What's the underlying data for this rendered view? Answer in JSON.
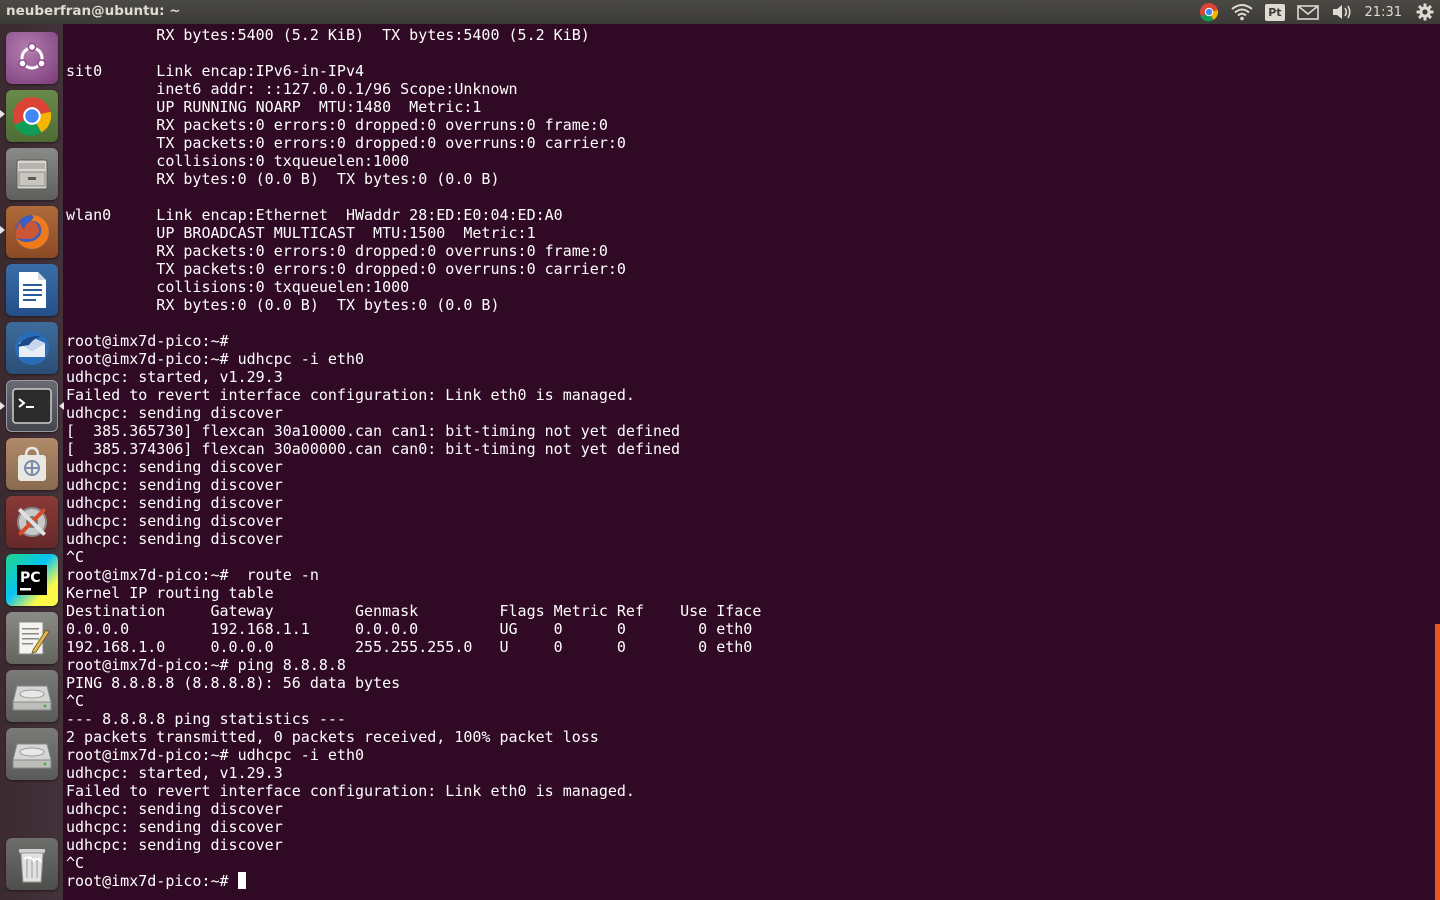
{
  "topbar": {
    "window_title": "neuberfran@ubuntu: ~",
    "clock": "21:31",
    "keyboard_layout": "Pt",
    "indicators": [
      "chrome-icon",
      "wifi-icon",
      "keyboard-layout-indicator",
      "mail-icon",
      "volume-icon",
      "settings-gear-icon"
    ]
  },
  "launcher": {
    "items": [
      {
        "name": "dash-home",
        "icon": "ubuntu-logo-icon"
      },
      {
        "name": "google-chrome",
        "icon": "chrome-icon"
      },
      {
        "name": "files",
        "icon": "file-cabinet-icon"
      },
      {
        "name": "firefox",
        "icon": "firefox-icon"
      },
      {
        "name": "libreoffice-writer",
        "icon": "writer-document-icon"
      },
      {
        "name": "thunderbird",
        "icon": "thunderbird-icon"
      },
      {
        "name": "terminal",
        "icon": "terminal-icon"
      },
      {
        "name": "software-center",
        "icon": "shopping-bag-icon"
      },
      {
        "name": "system-settings",
        "icon": "wrench-screwdriver-icon"
      },
      {
        "name": "pycharm",
        "icon": "pycharm-icon"
      },
      {
        "name": "text-editor",
        "icon": "text-editor-icon"
      },
      {
        "name": "drive-1",
        "icon": "hard-drive-icon"
      },
      {
        "name": "drive-2",
        "icon": "hard-drive-icon"
      },
      {
        "name": "trash",
        "icon": "trash-icon"
      }
    ]
  },
  "terminal": {
    "lines": [
      "          RX bytes:5400 (5.2 KiB)  TX bytes:5400 (5.2 KiB)",
      "",
      "sit0      Link encap:IPv6-in-IPv4",
      "          inet6 addr: ::127.0.0.1/96 Scope:Unknown",
      "          UP RUNNING NOARP  MTU:1480  Metric:1",
      "          RX packets:0 errors:0 dropped:0 overruns:0 frame:0",
      "          TX packets:0 errors:0 dropped:0 overruns:0 carrier:0",
      "          collisions:0 txqueuelen:1000",
      "          RX bytes:0 (0.0 B)  TX bytes:0 (0.0 B)",
      "",
      "wlan0     Link encap:Ethernet  HWaddr 28:ED:E0:04:ED:A0",
      "          UP BROADCAST MULTICAST  MTU:1500  Metric:1",
      "          RX packets:0 errors:0 dropped:0 overruns:0 frame:0",
      "          TX packets:0 errors:0 dropped:0 overruns:0 carrier:0",
      "          collisions:0 txqueuelen:1000",
      "          RX bytes:0 (0.0 B)  TX bytes:0 (0.0 B)",
      "",
      "root@imx7d-pico:~#",
      "root@imx7d-pico:~# udhcpc -i eth0",
      "udhcpc: started, v1.29.3",
      "Failed to revert interface configuration: Link eth0 is managed.",
      "udhcpc: sending discover",
      "[  385.365730] flexcan 30a10000.can can1: bit-timing not yet defined",
      "[  385.374306] flexcan 30a00000.can can0: bit-timing not yet defined",
      "udhcpc: sending discover",
      "udhcpc: sending discover",
      "udhcpc: sending discover",
      "udhcpc: sending discover",
      "udhcpc: sending discover",
      "^C",
      "root@imx7d-pico:~#  route -n",
      "Kernel IP routing table",
      "Destination     Gateway         Genmask         Flags Metric Ref    Use Iface",
      "0.0.0.0         192.168.1.1     0.0.0.0         UG    0      0        0 eth0",
      "192.168.1.0     0.0.0.0         255.255.255.0   U     0      0        0 eth0",
      "root@imx7d-pico:~# ping 8.8.8.8",
      "PING 8.8.8.8 (8.8.8.8): 56 data bytes",
      "^C",
      "--- 8.8.8.8 ping statistics ---",
      "2 packets transmitted, 0 packets received, 100% packet loss",
      "root@imx7d-pico:~# udhcpc -i eth0",
      "udhcpc: started, v1.29.3",
      "Failed to revert interface configuration: Link eth0 is managed.",
      "udhcpc: sending discover",
      "udhcpc: sending discover",
      "udhcpc: sending discover",
      "^C"
    ],
    "prompt": "root@imx7d-pico:~# ",
    "colors": {
      "background": "#300a24",
      "foreground": "#ffffff",
      "scrollbar": "#e95420"
    }
  }
}
